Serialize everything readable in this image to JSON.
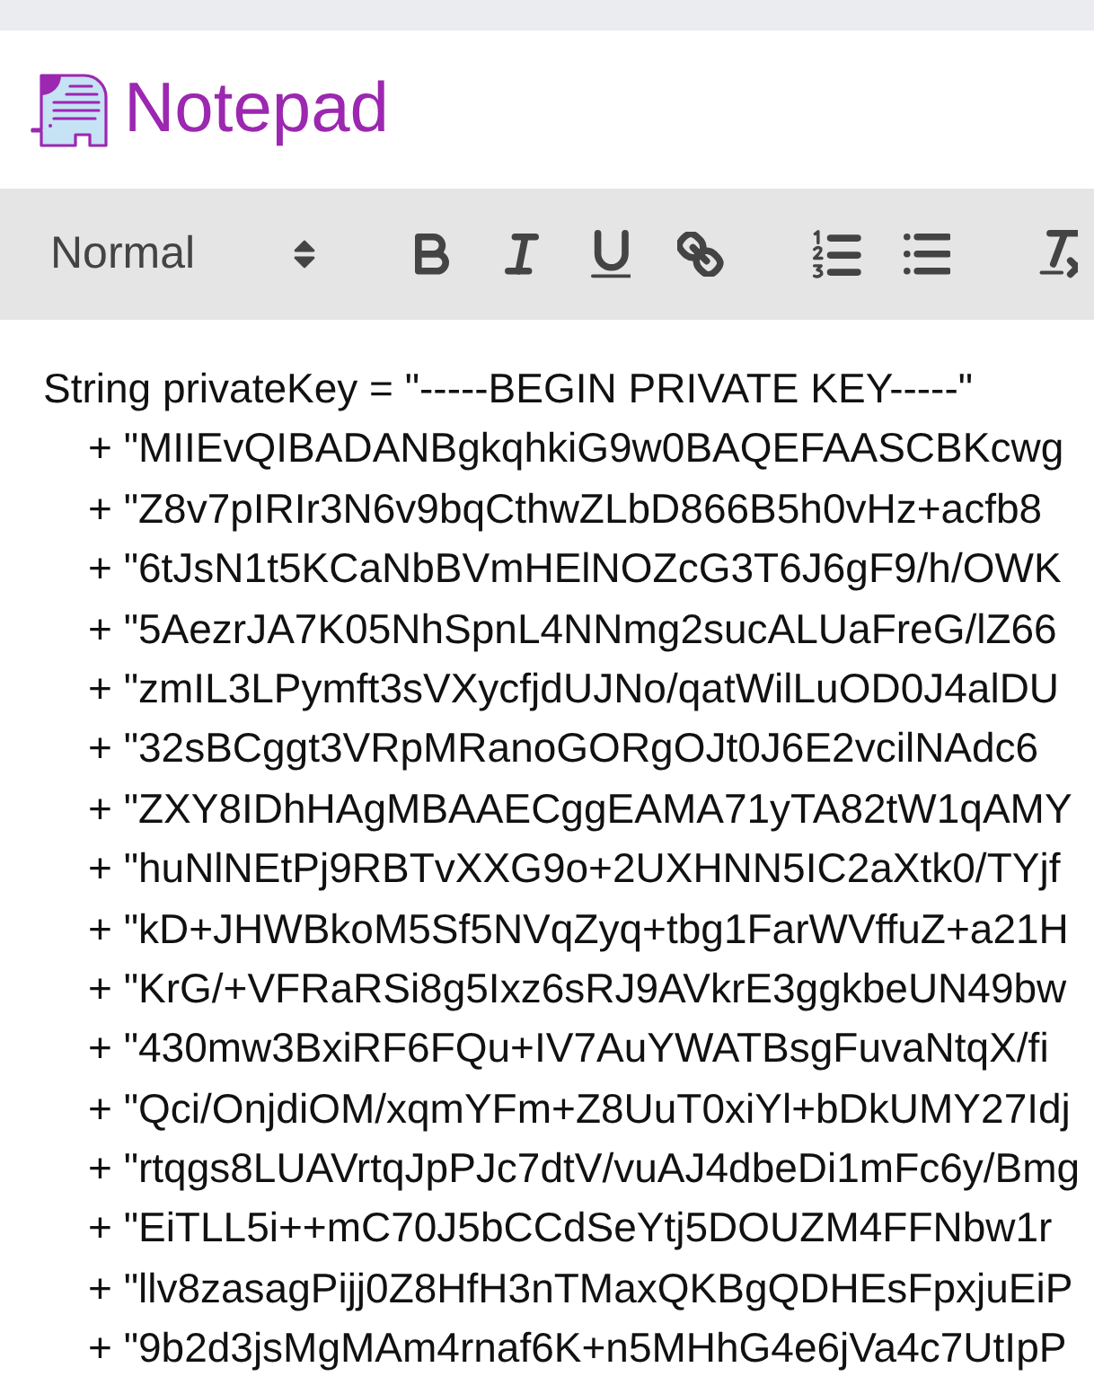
{
  "app": {
    "title": "Notepad"
  },
  "toolbar": {
    "format_select": {
      "value": "Normal"
    },
    "groups": [
      {
        "tools": [
          {
            "kind": "bold"
          },
          {
            "kind": "italic"
          },
          {
            "kind": "underline"
          },
          {
            "kind": "link"
          }
        ]
      },
      {
        "tools": [
          {
            "kind": "ordered_list"
          },
          {
            "kind": "bullet_list"
          }
        ]
      },
      {
        "tools": [
          {
            "kind": "clear_format"
          }
        ]
      }
    ]
  },
  "editor": {
    "lines": [
      {
        "kind": "statement",
        "text": "String privateKey = \"-----BEGIN PRIVATE KEY-----\""
      },
      {
        "kind": "continuation",
        "text": "+ \"MIIEvQIBADANBgkqhkiG9w0BAQEFAASCBKcwg"
      },
      {
        "kind": "continuation",
        "text": "+ \"Z8v7pIRIr3N6v9bqCthwZLbD866B5h0vHz+acfb8"
      },
      {
        "kind": "continuation",
        "text": "+ \"6tJsN1t5KCaNbBVmHElNOZcG3T6J6gF9/h/OWK"
      },
      {
        "kind": "continuation",
        "text": "+ \"5AezrJA7K05NhSpnL4NNmg2sucALUaFreG/lZ66"
      },
      {
        "kind": "continuation",
        "text": "+ \"zmIL3LPymft3sVXycfjdUJNo/qatWilLuOD0J4alDU"
      },
      {
        "kind": "continuation",
        "text": "+ \"32sBCggt3VRpMRanoGORgOJt0J6E2vcilNAdc6"
      },
      {
        "kind": "continuation",
        "text": "+ \"ZXY8IDhHAgMBAAECggEAMA71yTA82tW1qAMY"
      },
      {
        "kind": "continuation",
        "text": "+ \"huNlNEtPj9RBTvXXG9o+2UXHNN5IC2aXtk0/TYjf"
      },
      {
        "kind": "continuation",
        "text": "+ \"kD+JHWBkoM5Sf5NVqZyq+tbg1FarWVffuZ+a21H"
      },
      {
        "kind": "continuation",
        "text": "+ \"KrG/+VFRaRSi8g5Ixz6sRJ9AVkrE3ggkbeUN49bw"
      },
      {
        "kind": "continuation",
        "text": "+ \"430mw3BxiRF6FQu+IV7AuYWATBsgFuvaNtqX/fi"
      },
      {
        "kind": "continuation",
        "text": "+ \"Qci/OnjdiOM/xqmYFm+Z8UuT0xiYl+bDkUMY27Idj"
      },
      {
        "kind": "continuation",
        "text": "+ \"rtqgs8LUAVrtqJpPJc7dtV/vuAJ4dbeDi1mFc6y/Bmg"
      },
      {
        "kind": "continuation",
        "text": "+ \"EiTLL5i++mC70J5bCCdSeYtj5DOUZM4FFNbw1r"
      },
      {
        "kind": "continuation",
        "text": "+ \"llv8zasagPijj0Z8HfH3nTMaxQKBgQDHEsFpxjuEiP"
      },
      {
        "kind": "continuation",
        "text": "+ \"9b2d3jsMgMAm4rnaf6K+n5MHhG4e6jVa4c7UtIpP"
      }
    ]
  }
}
